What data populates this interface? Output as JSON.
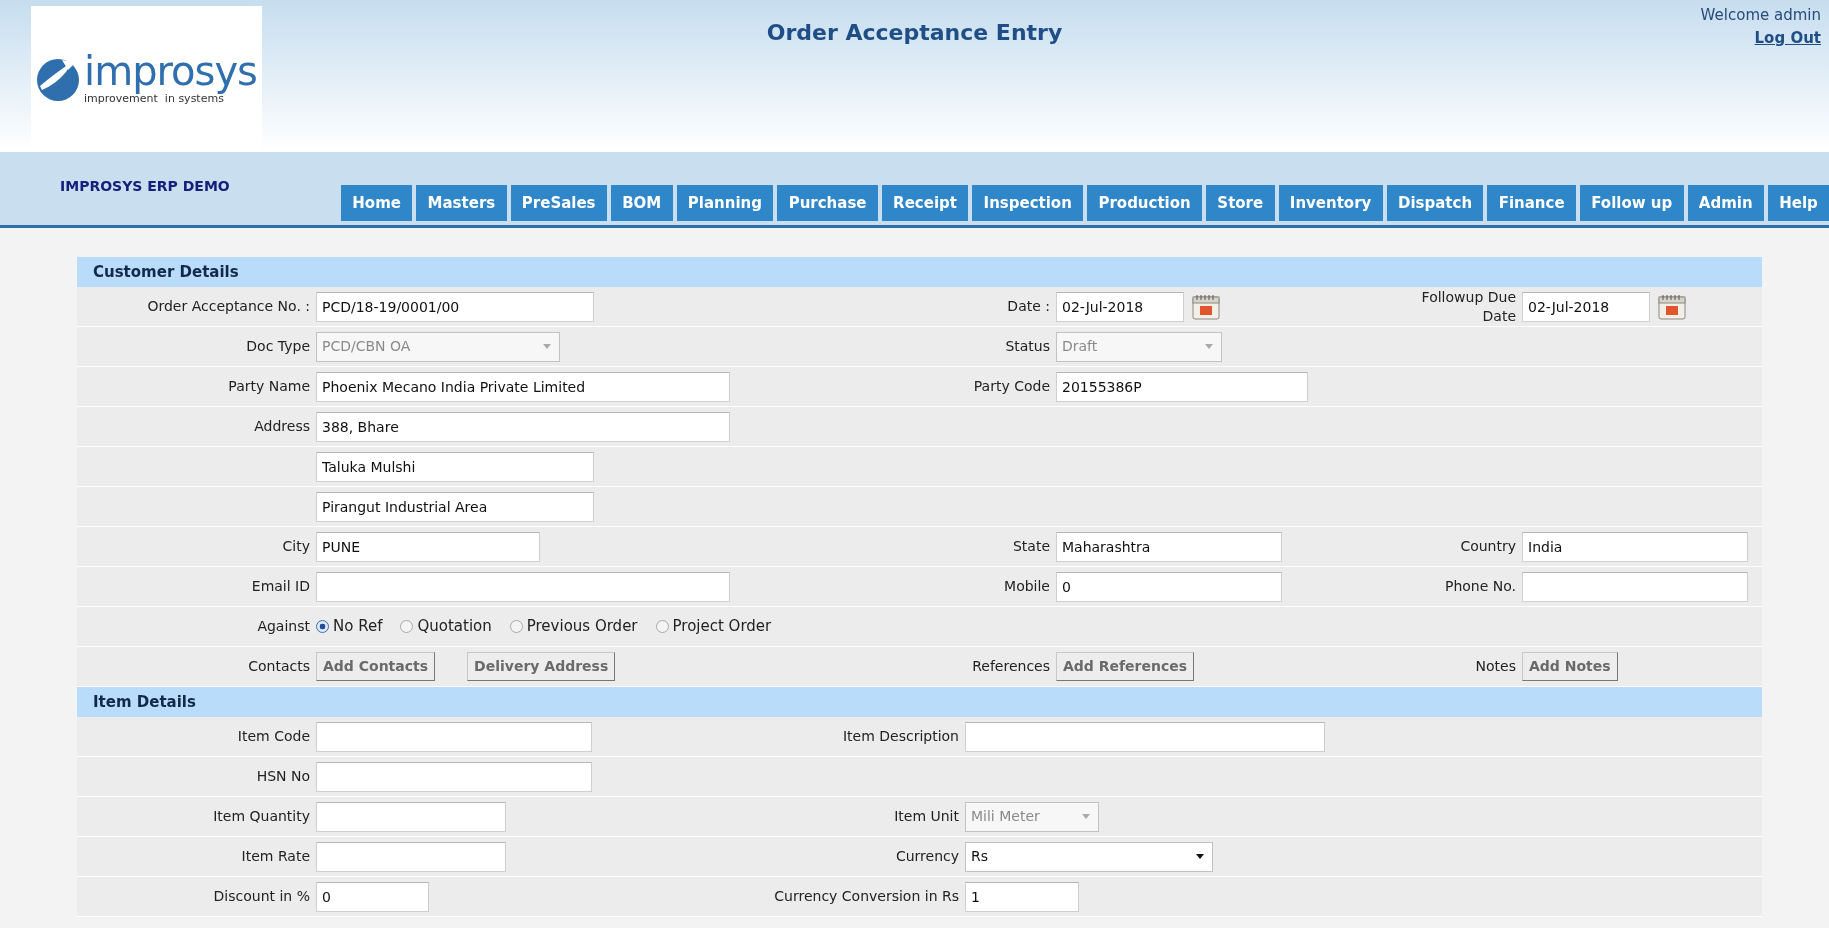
{
  "header": {
    "logo": {
      "name": "improsys",
      "tagline": "improvement  in systems"
    },
    "title": "Order Acceptance Entry",
    "welcome": "Welcome admin",
    "logout": "Log Out",
    "app_name": "IMPROSYS ERP DEMO"
  },
  "nav": [
    {
      "label": "Home"
    },
    {
      "label": "Masters"
    },
    {
      "label": "PreSales"
    },
    {
      "label": "BOM"
    },
    {
      "label": "Planning"
    },
    {
      "label": "Purchase"
    },
    {
      "label": "Receipt"
    },
    {
      "label": "Inspection"
    },
    {
      "label": "Production"
    },
    {
      "label": "Store"
    },
    {
      "label": "Inventory"
    },
    {
      "label": "Dispatch"
    },
    {
      "label": "Finance"
    },
    {
      "label": "Follow up"
    },
    {
      "label": "Admin"
    },
    {
      "label": "Help"
    }
  ],
  "sections": [
    {
      "title": "Customer Details",
      "rows": [
        [
          {
            "label": "Order Acceptance No. :",
            "kind": "text",
            "value": "PCD/18-19/0001/00"
          },
          {
            "label": "Date :",
            "kind": "date",
            "value": "02-Jul-2018"
          },
          {
            "label": "Followup Due Date",
            "kind": "date",
            "value": "02-Jul-2018"
          }
        ],
        [
          {
            "label": "Doc Type",
            "kind": "select",
            "value": "PCD/CBN OA",
            "disabled": true
          },
          {
            "label": "Status",
            "kind": "select",
            "value": "Draft",
            "disabled": true
          }
        ],
        [
          {
            "label": "Party Name",
            "kind": "text",
            "value": "Phoenix Mecano India Private Limited"
          },
          {
            "label": "Party Code",
            "kind": "text",
            "value": "20155386P"
          }
        ],
        [
          {
            "label": "Address",
            "kind": "text",
            "value": "388, Bhare"
          }
        ],
        [
          {
            "kind": "text",
            "value": "Taluka Mulshi"
          }
        ],
        [
          {
            "kind": "text",
            "value": "Pirangut Industrial Area"
          }
        ],
        [
          {
            "label": "City",
            "kind": "text",
            "value": "PUNE"
          },
          {
            "label": "State",
            "kind": "text",
            "value": "Maharashtra"
          },
          {
            "label": "Country",
            "kind": "text",
            "value": "India"
          }
        ],
        [
          {
            "label": "Email ID",
            "kind": "text"
          },
          {
            "label": "Mobile",
            "kind": "text",
            "value": "0"
          },
          {
            "label": "Phone No.",
            "kind": "text"
          }
        ],
        [
          {
            "label": "Against",
            "kind": "radio",
            "options": [
              {
                "label": "No Ref",
                "selected": true
              },
              {
                "label": "Quotation",
                "selected": false
              },
              {
                "label": "Previous Order",
                "selected": false
              },
              {
                "label": "Project Order",
                "selected": false
              }
            ]
          }
        ],
        [
          {
            "label": "Contacts",
            "kind": "buttons",
            "buttons": [
              "Add Contacts",
              "Delivery Address"
            ]
          },
          {
            "label": "References",
            "kind": "buttons",
            "buttons": [
              "Add References"
            ]
          },
          {
            "label": "Notes",
            "kind": "buttons",
            "buttons": [
              "Add Notes"
            ]
          }
        ]
      ]
    },
    {
      "title": "Item Details",
      "rows": [
        [
          {
            "label": "Item Code",
            "kind": "text"
          },
          {
            "label": "Item Description",
            "kind": "text"
          }
        ],
        [
          {
            "label": "HSN No",
            "kind": "text"
          }
        ],
        [
          {
            "label": "Item Quantity",
            "kind": "text"
          },
          {
            "label": "Item Unit",
            "kind": "select",
            "value": "Mili Meter",
            "disabled": true
          }
        ],
        [
          {
            "label": "Item Rate",
            "kind": "text"
          },
          {
            "label": "Currency",
            "kind": "select",
            "value": "Rs",
            "disabled": false
          }
        ],
        [
          {
            "label": "Discount in %",
            "kind": "text",
            "value": "0"
          },
          {
            "label": "Currency Conversion in Rs",
            "kind": "text",
            "value": "1"
          }
        ]
      ]
    }
  ]
}
